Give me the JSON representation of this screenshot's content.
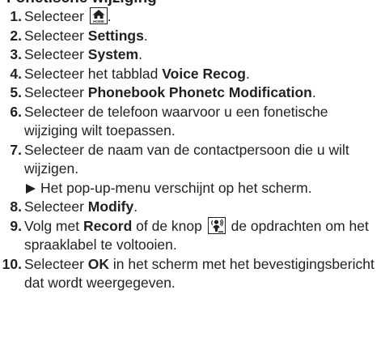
{
  "heading": "Fonetische wijziging",
  "home_icon_label": "HOME",
  "steps": [
    {
      "num": "1.",
      "parts": [
        "Selecteer ",
        "."
      ]
    },
    {
      "num": "2.",
      "pre": "Selecteer ",
      "bold": "Settings",
      "post": "."
    },
    {
      "num": "3.",
      "pre": "Selecteer ",
      "bold": "System",
      "post": "."
    },
    {
      "num": "4.",
      "pre": "Selecteer het tabblad ",
      "bold": "Voice Recog",
      "post": "."
    },
    {
      "num": "5.",
      "pre": "Selecteer ",
      "bold": "Phonebook Phonetc Modification",
      "post": "."
    },
    {
      "num": "6.",
      "text": "Selecteer de telefoon waarvoor u een fonetische wijziging wilt toepassen."
    },
    {
      "num": "7.",
      "text": "Selecteer de naam van de contactpersoon die u wilt wijzigen.",
      "sub": "Het pop-up-menu verschijnt op het scherm."
    },
    {
      "num": "8.",
      "pre": "Selecteer ",
      "bold": "Modify",
      "post": "."
    },
    {
      "num": "9.",
      "pre": "Volg met ",
      "bold": "Record",
      "mid": " of de knop ",
      "post": " de opdrachten om het spraaklabel te voltooien."
    },
    {
      "num": "10.",
      "pre": "Selecteer ",
      "bold": "OK",
      "post": " in het scherm met het bevestigingsbericht dat wordt weergegeven."
    }
  ]
}
